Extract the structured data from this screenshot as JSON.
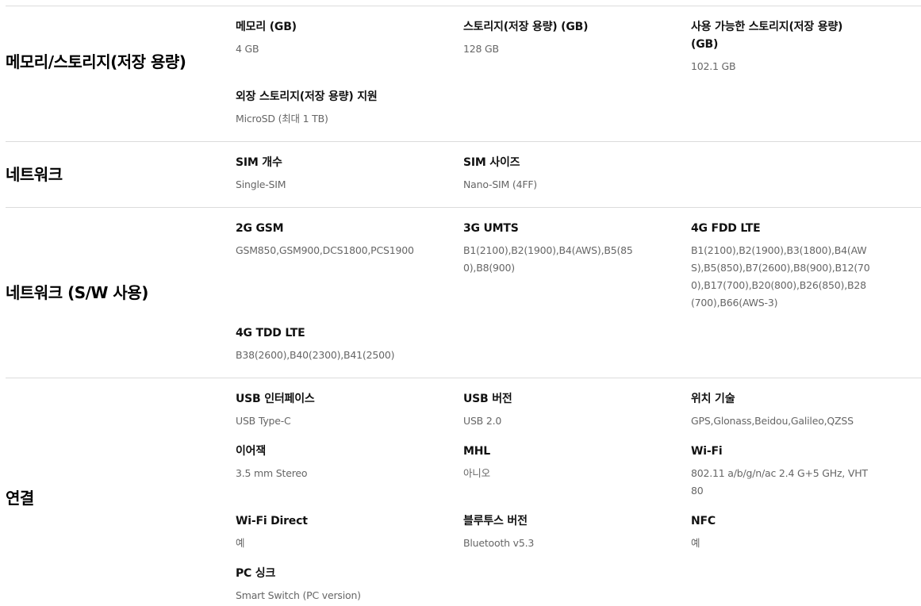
{
  "sections": [
    {
      "title": "메모리/스토리지(저장 용량)",
      "items": [
        {
          "label": "메모리 (GB)",
          "value": "4 GB"
        },
        {
          "label": "스토리지(저장 용량) (GB)",
          "value": "128 GB"
        },
        {
          "label": "사용 가능한 스토리지(저장 용량) (GB)",
          "value": "102.1 GB"
        },
        {
          "label": "외장 스토리지(저장 용량) 지원",
          "value": "MicroSD (최대 1 TB)"
        }
      ]
    },
    {
      "title": "네트워크",
      "items": [
        {
          "label": "SIM 개수",
          "value": "Single-SIM"
        },
        {
          "label": "SIM 사이즈",
          "value": "Nano-SIM (4FF)"
        }
      ]
    },
    {
      "title": "네트워크 (S/W 사용)",
      "items": [
        {
          "label": "2G GSM",
          "value": "GSM850,GSM900,DCS1800,PCS1900"
        },
        {
          "label": "3G UMTS",
          "value": "B1(2100),B2(1900),B4(AWS),B5(850),B8(900)"
        },
        {
          "label": "4G FDD LTE",
          "value": "B1(2100),B2(1900),B3(1800),B4(AWS),B5(850),B7(2600),B8(900),B12(700),B17(700),B20(800),B26(850),B28(700),B66(AWS-3)"
        },
        {
          "label": "4G TDD LTE",
          "value": "B38(2600),B40(2300),B41(2500)"
        }
      ]
    },
    {
      "title": "연결",
      "items": [
        {
          "label": "USB 인터페이스",
          "value": "USB Type-C"
        },
        {
          "label": "USB 버전",
          "value": "USB 2.0"
        },
        {
          "label": "위치 기술",
          "value": "GPS,Glonass,Beidou,Galileo,QZSS"
        },
        {
          "label": "이어잭",
          "value": "3.5 mm Stereo"
        },
        {
          "label": "MHL",
          "value": "아니오"
        },
        {
          "label": "Wi-Fi",
          "value": "802.11 a/b/g/n/ac 2.4 G+5 GHz, VHT80"
        },
        {
          "label": "Wi-Fi Direct",
          "value": "예"
        },
        {
          "label": "블루투스 버전",
          "value": "Bluetooth v5.3"
        },
        {
          "label": "NFC",
          "value": "예"
        },
        {
          "label": "PC 싱크",
          "value": "Smart Switch (PC version)"
        }
      ]
    }
  ]
}
